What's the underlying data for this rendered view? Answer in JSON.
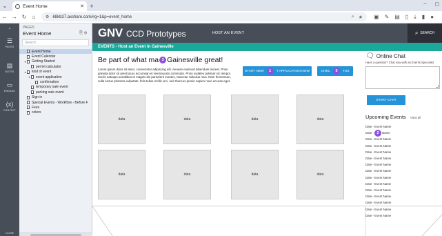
{
  "browser": {
    "tab_title": "Event Home",
    "url": "68kb37.axshare.com/#g=1&p=event_home",
    "new_tab": "+",
    "tab_close": "✕"
  },
  "rail": {
    "items": [
      {
        "label": "PAGES",
        "icon": "pages-icon"
      },
      {
        "label": "NOTES",
        "icon": "notes-icon"
      },
      {
        "label": "ENGAGE",
        "icon": "engage-icon"
      },
      {
        "label": "CONTEXT",
        "icon": "context-icon"
      }
    ],
    "close": "CLOSE"
  },
  "panel": {
    "header": "PAGES",
    "title": "Event Home",
    "search_placeholder": "Search",
    "tree": [
      {
        "label": "Event Home",
        "level": 1,
        "twisty": "",
        "selected": true
      },
      {
        "label": "Event Calendar",
        "level": 1,
        "twisty": ""
      },
      {
        "label": "Getting Started",
        "level": 1,
        "twisty": "▾"
      },
      {
        "label": "permit calculator",
        "level": 2,
        "twisty": ""
      },
      {
        "label": "kind of event",
        "level": 1,
        "twisty": "▾"
      },
      {
        "label": "event application",
        "level": 2,
        "twisty": "▾"
      },
      {
        "label": "confirmation",
        "level": 3,
        "twisty": ""
      },
      {
        "label": "temporary sale event",
        "level": 2,
        "twisty": ""
      },
      {
        "label": "parking sale event",
        "level": 2,
        "twisty": ""
      },
      {
        "label": "Sign in",
        "level": 1,
        "twisty": ""
      },
      {
        "label": "Special Events - Workflow - Before F",
        "level": 1,
        "twisty": ""
      },
      {
        "label": "Fees",
        "level": 1,
        "twisty": ""
      },
      {
        "label": "colors",
        "level": 1,
        "twisty": ""
      }
    ]
  },
  "site": {
    "logo": "GNV",
    "logo_sub": "CCD Prototypes",
    "host_link": "HOST AN EVENT",
    "search_label": "SEARCH",
    "band": "EVENTS - Host an Event in Gainesville",
    "heading_pre": "Be part of what ma",
    "heading_post": "Gainesville great!",
    "lorem": "Lorem ipsum dolor sit amet, consectetur adipiscing elit. Aenean euismod bibendum laoreet. Proin gravida dolor sit amet lacus accumsan et viverra justo commodo. Proin sodales pulvinar sic tempor. Sociis natoque penatibus et magnis dis parturient montes, nascetur ridiculus mus. Nam fermentum, nulla luctus pharetra vulputate, felis tellus mollis orci, sed rhoncus pronin sapien nunc accuan eget.",
    "btn_start_pre": "START NEW",
    "btn_start_post": "T APPLICATION NOW",
    "btn_check_pre": "CHEC",
    "btn_check_post": "TUS",
    "data_cells": [
      "data",
      "data",
      "data",
      "data",
      "data",
      "data",
      "data",
      "data"
    ],
    "chat_title": "Online Chat",
    "chat_sub": "Have a question? Chat now with an Events Specialist",
    "chat_button": "START CHAT",
    "upcoming_title": "Upcoming Events",
    "view_all": "View all",
    "events": [
      "Date - Event Name",
      "Date - Event Name",
      "Date - Event Name",
      "Date - Event Name",
      "Date - Event Name",
      "Date - Event Name",
      "Date - Event Name",
      "Date - Event Name",
      "Date - Event Name",
      "Date - Event Name",
      "Date - Event Name",
      "Date - Event Name",
      "Date - Event Name",
      "Date - Event Name",
      "Date - Event Name"
    ]
  },
  "badges": {
    "b1": "1",
    "b2": "2",
    "b3": "3",
    "b5": "5"
  },
  "colors": {
    "accent": "#1aa89b",
    "button": "#2593d8",
    "badge": "#8c52d9",
    "header": "#474e57"
  }
}
